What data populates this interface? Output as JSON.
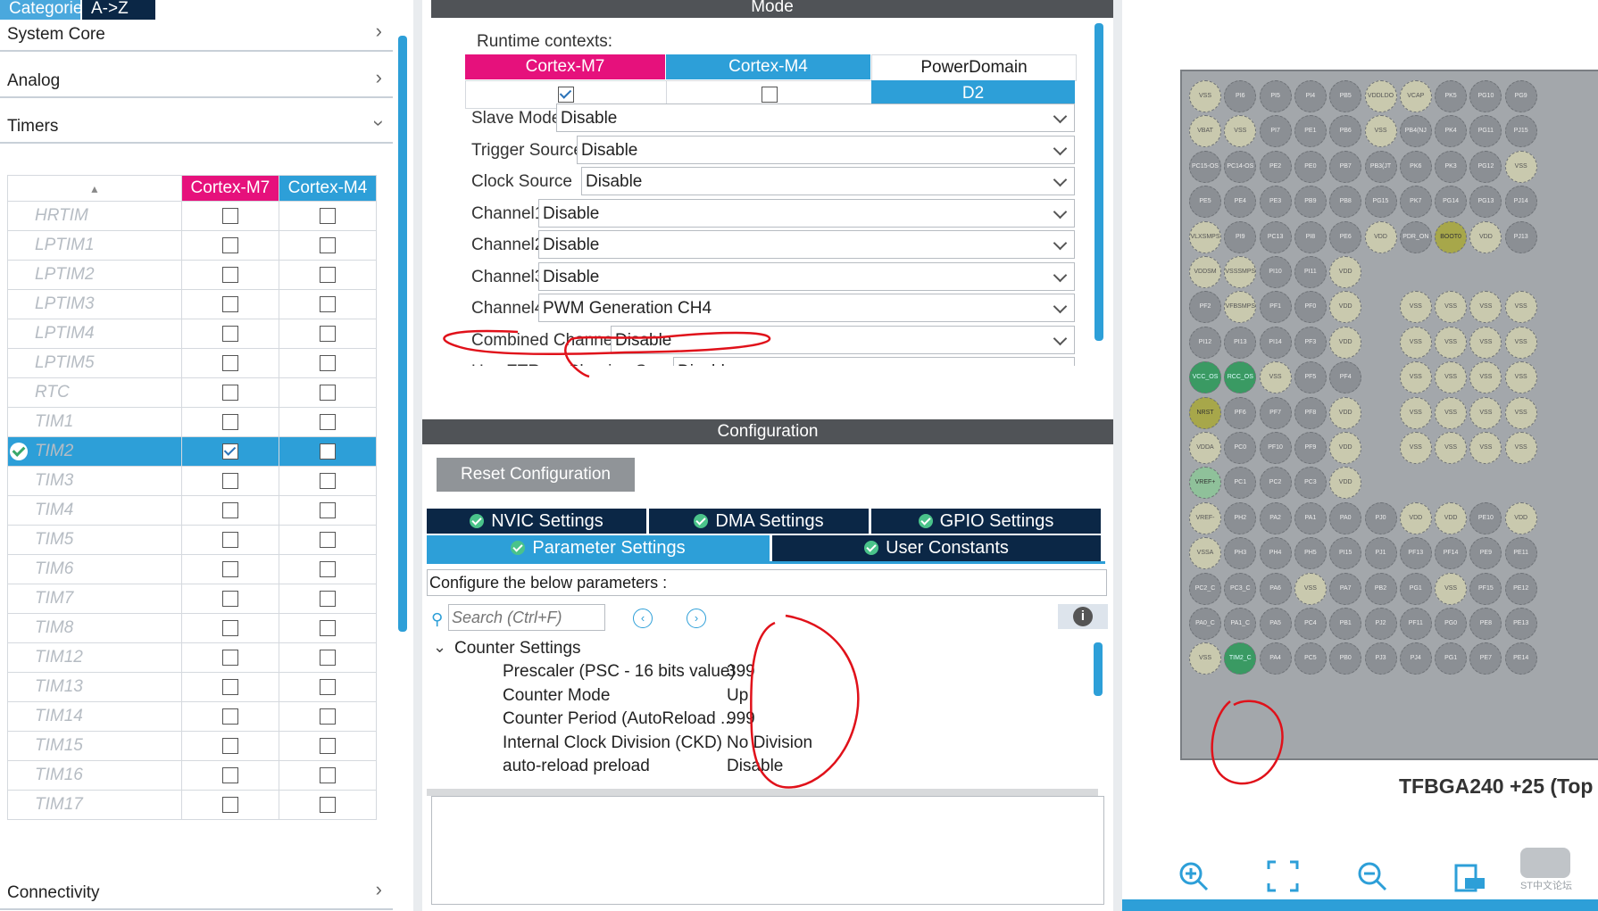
{
  "left": {
    "tabs": [
      "Categories",
      "A->Z"
    ],
    "categories": [
      {
        "label": "System Core"
      },
      {
        "label": "Analog"
      },
      {
        "label": "Timers"
      }
    ],
    "bottom_category": "Connectivity",
    "table_headers": [
      "Cortex-M7",
      "Cortex-M4"
    ],
    "timers": [
      {
        "name": "HRTIM",
        "m7": false,
        "m4": false
      },
      {
        "name": "LPTIM1",
        "m7": false,
        "m4": false
      },
      {
        "name": "LPTIM2",
        "m7": false,
        "m4": false
      },
      {
        "name": "LPTIM3",
        "m7": false,
        "m4": false
      },
      {
        "name": "LPTIM4",
        "m7": false,
        "m4": false
      },
      {
        "name": "LPTIM5",
        "m7": false,
        "m4": false
      },
      {
        "name": "RTC",
        "m7": false,
        "m4": false
      },
      {
        "name": "TIM1",
        "m7": false,
        "m4": false
      },
      {
        "name": "TIM2",
        "m7": true,
        "m4": false,
        "selected": true
      },
      {
        "name": "TIM3",
        "m7": false,
        "m4": false
      },
      {
        "name": "TIM4",
        "m7": false,
        "m4": false
      },
      {
        "name": "TIM5",
        "m7": false,
        "m4": false
      },
      {
        "name": "TIM6",
        "m7": false,
        "m4": false
      },
      {
        "name": "TIM7",
        "m7": false,
        "m4": false
      },
      {
        "name": "TIM8",
        "m7": false,
        "m4": false
      },
      {
        "name": "TIM12",
        "m7": false,
        "m4": false
      },
      {
        "name": "TIM13",
        "m7": false,
        "m4": false
      },
      {
        "name": "TIM14",
        "m7": false,
        "m4": false
      },
      {
        "name": "TIM15",
        "m7": false,
        "m4": false
      },
      {
        "name": "TIM16",
        "m7": false,
        "m4": false
      },
      {
        "name": "TIM17",
        "m7": false,
        "m4": false
      }
    ]
  },
  "mode": {
    "header": "Mode",
    "runtime_label": "Runtime contexts:",
    "contexts": [
      "Cortex-M7",
      "Cortex-M4",
      "PowerDomain"
    ],
    "context_m7_checked": true,
    "context_m4_checked": false,
    "power_domain_value": "D2",
    "fields": [
      {
        "label": "Slave Mode",
        "value": "Disable"
      },
      {
        "label": "Trigger Source",
        "value": "Disable"
      },
      {
        "label": "Clock Source",
        "value": "Disable"
      },
      {
        "label": "Channel1",
        "value": "Disable"
      },
      {
        "label": "Channel2",
        "value": "Disable"
      },
      {
        "label": "Channel3",
        "value": "Disable"
      },
      {
        "label": "Channel4",
        "value": "PWM Generation CH4"
      },
      {
        "label": "Combined Channels",
        "value": "Disable"
      },
      {
        "label": "Use ETR as Clearing Source",
        "value": "Disable"
      }
    ]
  },
  "config": {
    "header": "Configuration",
    "reset_button": "Reset Configuration",
    "tabs_row1": [
      "NVIC Settings",
      "DMA Settings",
      "GPIO Settings"
    ],
    "tabs_row2": [
      "Parameter Settings",
      "User Constants"
    ],
    "instruction": "Configure the below parameters :",
    "search_placeholder": "Search (Ctrl+F)",
    "group": "Counter Settings",
    "params": [
      {
        "name": "Prescaler (PSC - 16 bits value)",
        "value": "399"
      },
      {
        "name": "Counter Mode",
        "value": "Up"
      },
      {
        "name": "Counter Period (AutoReload ...",
        "value": "999"
      },
      {
        "name": "Internal Clock Division (CKD)",
        "value": "No Division"
      },
      {
        "name": "auto-reload preload",
        "value": "Disable"
      }
    ]
  },
  "pinout": {
    "package_label": "TFBGA240 +25 (Top",
    "watermark": "ST中文论坛",
    "rows": [
      [
        "VSS",
        "PI6",
        "PI5",
        "PI4",
        "PB5",
        "VDDLDO",
        "VCAP",
        "PK5",
        "PG10",
        "PG9"
      ],
      [
        "VBAT",
        "VSS",
        "PI7",
        "PE1",
        "PB6",
        "VSS",
        "PB4(NJ",
        "PK4",
        "PG11",
        "PJ15"
      ],
      [
        "PC15-OS",
        "PC14-OS",
        "PE2",
        "PE0",
        "PB7",
        "PB3(JT",
        "PK6",
        "PK3",
        "PG12",
        "VSS"
      ],
      [
        "PE5",
        "PE4",
        "PE3",
        "PB9",
        "PB8",
        "PG15",
        "PK7",
        "PG14",
        "PG13",
        "PJ14"
      ],
      [
        "VLXSMPS",
        "PI9",
        "PC13",
        "PI8",
        "PE6",
        "VDD",
        "PDR_ON",
        "BOOT0",
        "VDD",
        "PJ13"
      ],
      [
        "VDDSM",
        "VSSSMPS",
        "PI10",
        "PI11",
        "VDD",
        "",
        "",
        "",
        "",
        ""
      ],
      [
        "PF2",
        "VFBSMPS",
        "PF1",
        "PF0",
        "VDD",
        "",
        "VSS",
        "VSS",
        "VSS",
        "VSS"
      ],
      [
        "PI12",
        "PI13",
        "PI14",
        "PF3",
        "VDD",
        "",
        "VSS",
        "VSS",
        "VSS",
        "VSS"
      ],
      [
        "VCC_OS",
        "RCC_OS",
        "VSS",
        "PF5",
        "PF4",
        "",
        "VSS",
        "VSS",
        "VSS",
        "VSS"
      ],
      [
        "NRST",
        "PF6",
        "PF7",
        "PF8",
        "VDD",
        "",
        "VSS",
        "VSS",
        "VSS",
        "VSS"
      ],
      [
        "VDDA",
        "PC0",
        "PF10",
        "PF9",
        "VDD",
        "",
        "VSS",
        "VSS",
        "VSS",
        "VSS"
      ],
      [
        "VREF+",
        "PC1",
        "PC2",
        "PC3",
        "VDD",
        "",
        "",
        "",
        "",
        ""
      ],
      [
        "VREF-",
        "PH2",
        "PA2",
        "PA1",
        "PA0",
        "PJ0",
        "VDD",
        "VDD",
        "PE10",
        "VDD"
      ],
      [
        "VSSA",
        "PH3",
        "PH4",
        "PH5",
        "PI15",
        "PJ1",
        "PF13",
        "PF14",
        "PE9",
        "PE11"
      ],
      [
        "PC2_C",
        "PC3_C",
        "PA6",
        "VSS",
        "PA7",
        "PB2",
        "PG1",
        "VSS",
        "PF15",
        "PE12"
      ],
      [
        "PA0_C",
        "PA1_C",
        "PA5",
        "PC4",
        "PB1",
        "PJ2",
        "PF11",
        "PG0",
        "PE8",
        "PE13"
      ],
      [
        "VSS",
        "TIM2_C",
        "PA4",
        "PC5",
        "PB0",
        "PJ3",
        "PJ4",
        "PG1",
        "PE7",
        "PE14"
      ]
    ]
  },
  "colors": {
    "m7": "#e6117c",
    "m4": "#2d9fd8",
    "navy": "#0b2746",
    "annotation": "#e0111a"
  }
}
